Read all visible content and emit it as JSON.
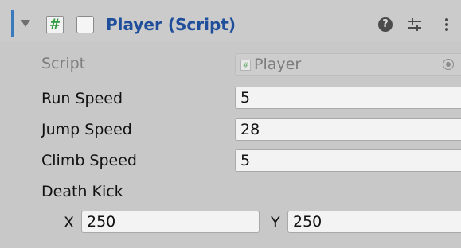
{
  "component": {
    "icon_glyph": "#",
    "title": "Player (Script)",
    "enabled": false,
    "help_glyph": "?",
    "accent_color": "#3a79bb",
    "title_color": "#1f4f9a"
  },
  "fields": {
    "script": {
      "label": "Script",
      "value": "Player",
      "icon": "script-icon"
    },
    "run_speed": {
      "label": "Run Speed",
      "value": "5"
    },
    "jump_speed": {
      "label": "Jump Speed",
      "value": "28"
    },
    "climb_speed": {
      "label": "Climb Speed",
      "value": "5"
    },
    "death_kick": {
      "label": "Death Kick",
      "x_label": "X",
      "x_value": "250",
      "y_label": "Y",
      "y_value": "250"
    }
  }
}
